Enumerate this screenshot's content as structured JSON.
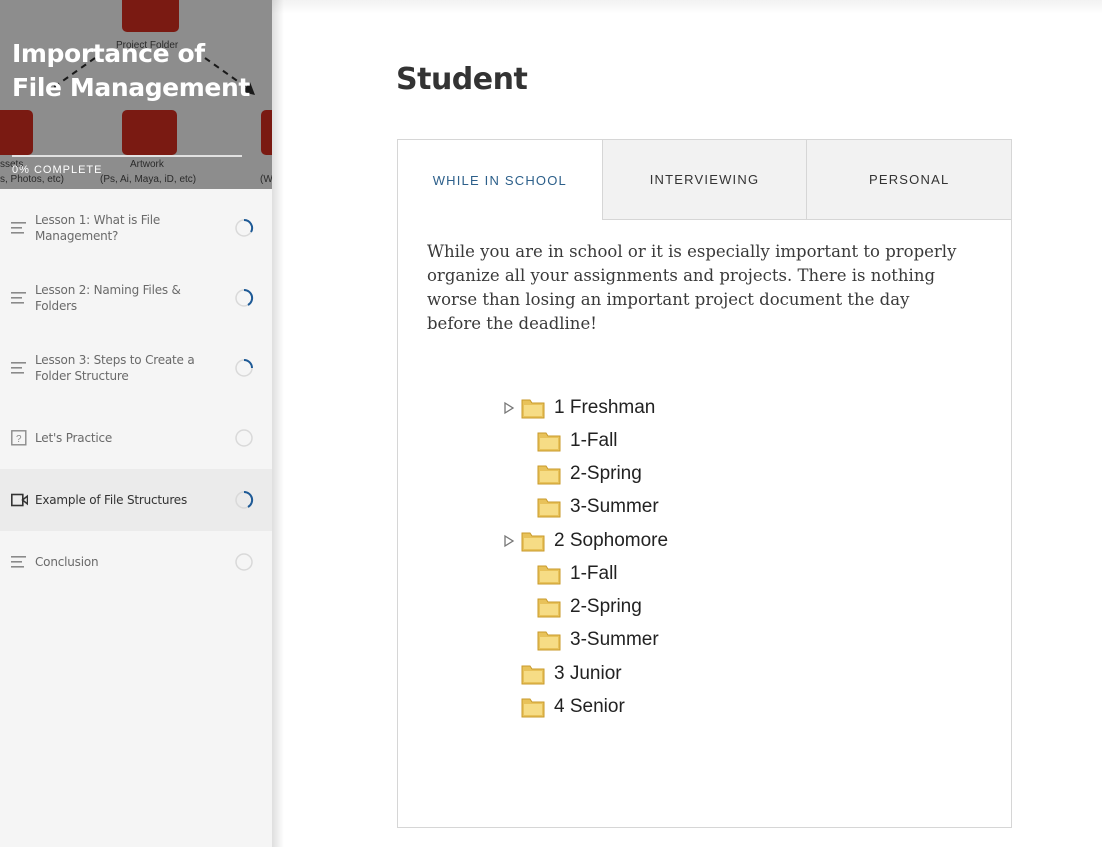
{
  "course": {
    "title_line1": "Importance of",
    "title_line2": "File Management",
    "progress_text": "0% COMPLETE",
    "hero_captions": {
      "project_folder": "Project Folder",
      "artwork": "Artwork",
      "artwork_sub": "(Ps, Ai, Maya, iD, etc)",
      "assets": "ssets",
      "assets_sub": "s, Photos, etc)",
      "right_sub": "(W"
    }
  },
  "sidebar": {
    "lessons": [
      {
        "label": "Lesson 1: What is File Management?",
        "icon": "lines-icon",
        "status": "in-progress"
      },
      {
        "label": "Lesson 2: Naming Files & Folders",
        "icon": "lines-icon",
        "status": "in-progress"
      },
      {
        "label": "Lesson 3: Steps to Create a Folder Structure",
        "icon": "lines-icon",
        "status": "in-progress"
      },
      {
        "label": "Let's Practice",
        "icon": "quiz-icon",
        "status": "not-started"
      },
      {
        "label": "Example of File Structures",
        "icon": "video-icon",
        "status": "in-progress"
      },
      {
        "label": "Conclusion",
        "icon": "lines-icon",
        "status": "not-started"
      }
    ]
  },
  "main": {
    "title": "Student",
    "tabs": [
      {
        "label": "WHILE IN SCHOOL"
      },
      {
        "label": "INTERVIEWING"
      },
      {
        "label": "PERSONAL"
      }
    ],
    "active_tab": "WHILE IN SCHOOL",
    "body_text": "While you are in school or it is especially important to properly organize all your assignments and projects.  There is nothing worse than losing an important project document the day before the deadline!",
    "folder_tree": [
      {
        "label": "1 Freshman",
        "level": 0,
        "expandable": true
      },
      {
        "label": "1-Fall",
        "level": 1,
        "expandable": false
      },
      {
        "label": "2-Spring",
        "level": 1,
        "expandable": false
      },
      {
        "label": "3-Summer",
        "level": 1,
        "expandable": false
      },
      {
        "label": "2 Sophomore",
        "level": 0,
        "expandable": true
      },
      {
        "label": "1-Fall",
        "level": 1,
        "expandable": false
      },
      {
        "label": "2-Spring",
        "level": 1,
        "expandable": false
      },
      {
        "label": "3-Summer",
        "level": 1,
        "expandable": false
      },
      {
        "label": "3 Junior",
        "level": 0,
        "expandable": false
      },
      {
        "label": "4 Senior",
        "level": 0,
        "expandable": false
      }
    ]
  },
  "colors": {
    "accent_tab": "#2c5f8a",
    "spinner": "#1e5a96",
    "hero_box": "#7a1a12"
  }
}
